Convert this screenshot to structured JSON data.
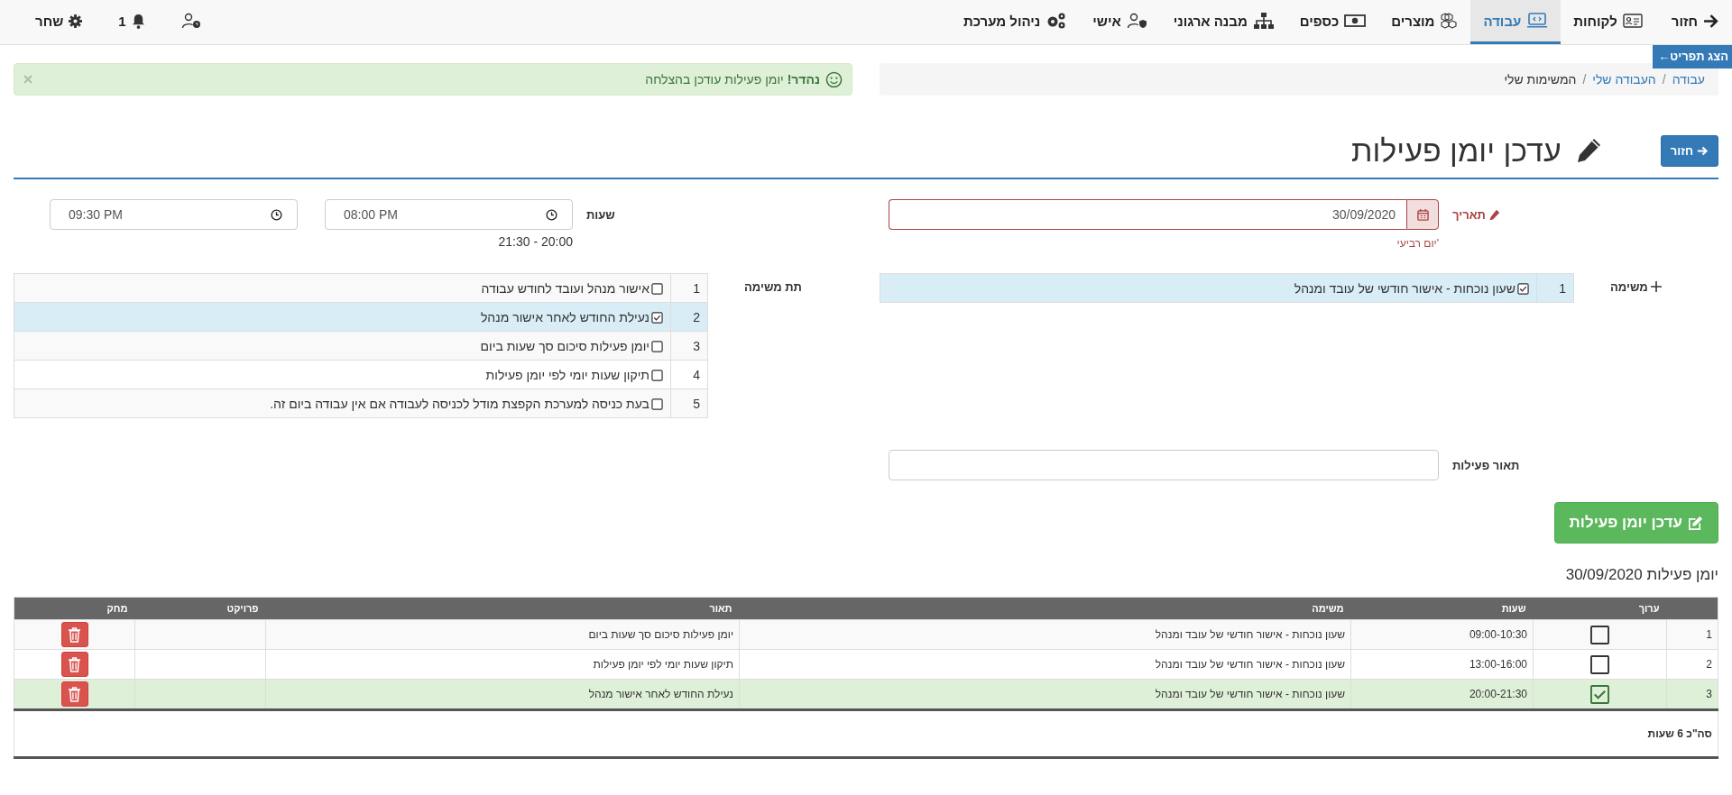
{
  "nav": {
    "back": "חזור",
    "items": [
      {
        "label": "לקוחות",
        "selected": false
      },
      {
        "label": "עבודה",
        "selected": true
      },
      {
        "label": "מוצרים",
        "selected": false
      },
      {
        "label": "כספים",
        "selected": false
      },
      {
        "label": "מבנה ארגוני",
        "selected": false
      },
      {
        "label": "אישי",
        "selected": false
      },
      {
        "label": "ניהול מערכת",
        "selected": false
      }
    ],
    "notifications": "1",
    "user": "שחר"
  },
  "menu_toggle": "הצג תפריט←",
  "breadcrumb": [
    "עבודה",
    "העבודה שלי",
    "המשימות שלי"
  ],
  "breadcrumb_separator": "/",
  "alert": "**נהדר!** יומן פעילות עודכן בהצלחה",
  "back_button": "חזור",
  "page_title": "עדכן יומן פעילות",
  "form": {
    "date": {
      "label": "תאריך",
      "value": "30/09/2020",
      "hint": "יום רביעי'",
      "invalid": true
    },
    "hours": {
      "label": "שעות",
      "from": "08:00 PM",
      "to": "09:30 PM",
      "range": "21:30 - 20:00"
    },
    "task": {
      "label": "משימה",
      "rows": [
        {
          "num": "1",
          "label": "שעון נוכחות - אישור חודשי של עובד ומנהל",
          "checked": true,
          "selected": true
        }
      ]
    },
    "subtask": {
      "label": "תת משימה",
      "rows": [
        {
          "num": "1",
          "label": "אישור מנהל ועובד לחודש עבודה",
          "checked": false,
          "selected": false
        },
        {
          "num": "2",
          "label": "נעילת החודש לאחר אישור מנהל",
          "checked": true,
          "selected": true
        },
        {
          "num": "3",
          "label": "יומן פעילות סיכום סך שעות ביום",
          "checked": false,
          "selected": false
        },
        {
          "num": "4",
          "label": "תיקון שעות יומי לפי יומן פעילות",
          "checked": false,
          "selected": false
        },
        {
          "num": "5",
          "label": "בעת כניסה למערכת הקפצת מודל לכניסה לעבודה אם אין עבודה ביום זה.",
          "checked": false,
          "selected": false
        }
      ]
    },
    "description": {
      "label": "תאור פעילות"
    },
    "submit": "עדכן יומן פעילות"
  },
  "log": {
    "title": "יומן פעילות 30/09/2020",
    "columns": [
      "ערוך",
      "שעות",
      "משימה",
      "תאור",
      "פרויקט",
      "מחק"
    ],
    "rows": [
      {
        "num": "1",
        "checked": false,
        "selected": false,
        "hours": "09:00-10:30",
        "task": "שעון נוכחות - אישור חודשי של עובד ומנהל",
        "description": "יומן פעילות סיכום סך שעות ביום"
      },
      {
        "num": "2",
        "checked": false,
        "selected": false,
        "hours": "13:00-16:00",
        "task": "שעון נוכחות - אישור חודשי של עובד ומנהל",
        "description": "תיקון שעות יומי לפי יומן פעילות"
      },
      {
        "num": "3",
        "checked": true,
        "selected": true,
        "hours": "20:00-21:30",
        "task": "שעון נוכחות - אישור חודשי של עובד ומנהל",
        "description": "נעילת החודש לאחר אישור מנהל"
      }
    ],
    "total": "סה\"כ 6 שעות"
  }
}
